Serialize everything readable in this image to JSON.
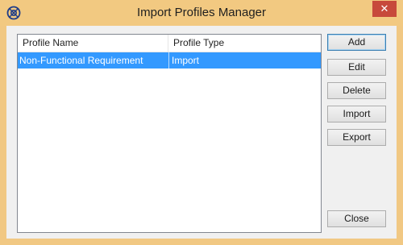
{
  "window": {
    "title": "Import Profiles Manager",
    "close_glyph": "✕",
    "app_icon": "ea-logo-icon",
    "accent_color": "#f2c981"
  },
  "list": {
    "columns": [
      "Profile Name",
      "Profile Type"
    ],
    "rows": [
      {
        "name": "Non-Functional Requirement",
        "type": "Import",
        "selected": true
      }
    ],
    "selection_color": "#3399ff"
  },
  "buttons": {
    "add": "Add",
    "edit": "Edit",
    "delete": "Delete",
    "import": "Import",
    "export": "Export",
    "close": "Close"
  }
}
